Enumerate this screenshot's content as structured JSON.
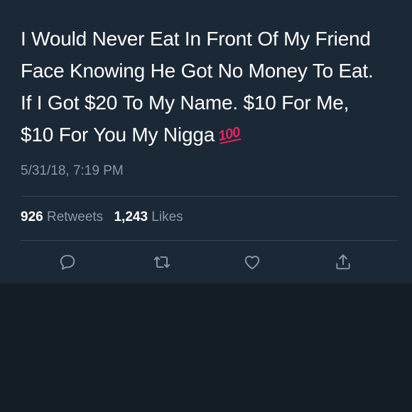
{
  "tweet": {
    "text_lines": [
      "I Would Never Eat In Front Of My Friend",
      "Face Knowing He Got No Money To Eat.",
      "If I Got $20 To My Name. $10 For Me,",
      "$10 For You My Nigga"
    ],
    "emoji": "100",
    "timestamp": "5/31/18, 7:19 PM"
  },
  "stats": {
    "retweets_count": "926",
    "retweets_label": "Retweets",
    "likes_count": "1,243",
    "likes_label": "Likes"
  },
  "actions": {
    "icons": [
      "reply-icon",
      "retweet-icon",
      "like-icon",
      "share-icon"
    ]
  },
  "colors": {
    "background": "#141d26",
    "card": "#1b2836",
    "text": "#ffffff",
    "muted": "#8899a6",
    "divider": "#38444d",
    "emoji": "#e0245e"
  }
}
